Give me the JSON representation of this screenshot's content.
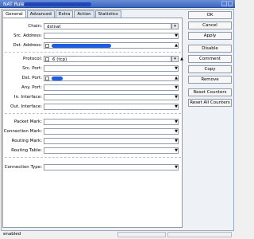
{
  "window": {
    "title": "NAT Rule"
  },
  "tabs": [
    "General",
    "Advanced",
    "Extra",
    "Action",
    "Statistics"
  ],
  "form": {
    "chain": {
      "label": "Chain:",
      "value": "dstnat"
    },
    "src_address": {
      "label": "Src. Address:"
    },
    "dst_address": {
      "label": "Dst. Address:"
    },
    "protocol": {
      "label": "Protocol:",
      "value": "6 (tcp)"
    },
    "src_port": {
      "label": "Src. Port:"
    },
    "dst_port": {
      "label": "Dst. Port:"
    },
    "any_port": {
      "label": "Any. Port:"
    },
    "in_interface": {
      "label": "In. Interface:"
    },
    "out_interface": {
      "label": "Out. Interface:"
    },
    "packet_mark": {
      "label": "Packet Mark:"
    },
    "connection_mark": {
      "label": "Connection Mark:"
    },
    "routing_mark": {
      "label": "Routing Mark:"
    },
    "routing_table": {
      "label": "Routing Table:"
    },
    "connection_type": {
      "label": "Connection Type:"
    }
  },
  "buttons": {
    "ok": "OK",
    "cancel": "Cancel",
    "apply": "Apply",
    "disable": "Disable",
    "comment": "Comment",
    "copy": "Copy",
    "remove": "Remove",
    "reset_counters": "Reset Counters",
    "reset_all_counters": "Reset All Counters"
  },
  "status": {
    "text": "enabled"
  },
  "icons": {
    "dropdown": "dropdown-icon",
    "expand_down": "triangle-down-icon",
    "expand_up": "triangle-up-icon"
  },
  "colors": {
    "title_bar": "#3c66c0",
    "redaction": "#1f5de0"
  }
}
